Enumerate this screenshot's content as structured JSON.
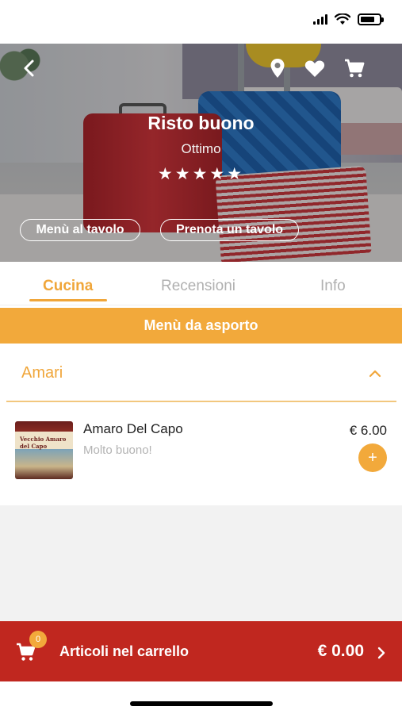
{
  "status_bar": {
    "icons": [
      "signal-icon",
      "wifi-icon",
      "battery-icon"
    ]
  },
  "hero": {
    "name": "Risto buono",
    "subtitle": "Ottimo",
    "stars": "★★★★★",
    "rating": 5,
    "buttons": {
      "menu_table": "Menù al tavolo",
      "book_table": "Prenota un tavolo"
    },
    "icons": [
      "back-icon",
      "location-pin-icon",
      "heart-icon",
      "cart-icon"
    ]
  },
  "tabs": [
    {
      "label": "Cucina",
      "active": true
    },
    {
      "label": "Recensioni",
      "active": false
    },
    {
      "label": "Info",
      "active": false
    }
  ],
  "banner": "Menù da asporto",
  "section": {
    "title": "Amari",
    "expanded": true
  },
  "items": [
    {
      "name": "Amaro Del Capo",
      "description": "Molto buono!",
      "price": "€ 6.00",
      "image_text": [
        "Vecchio Amaro",
        "del Capo"
      ]
    }
  ],
  "cart": {
    "badge": "0",
    "label": "Articoli nel carrello",
    "total": "€ 0.00"
  },
  "colors": {
    "accent": "#f2a93b",
    "cart_bar": "#c0271f"
  }
}
